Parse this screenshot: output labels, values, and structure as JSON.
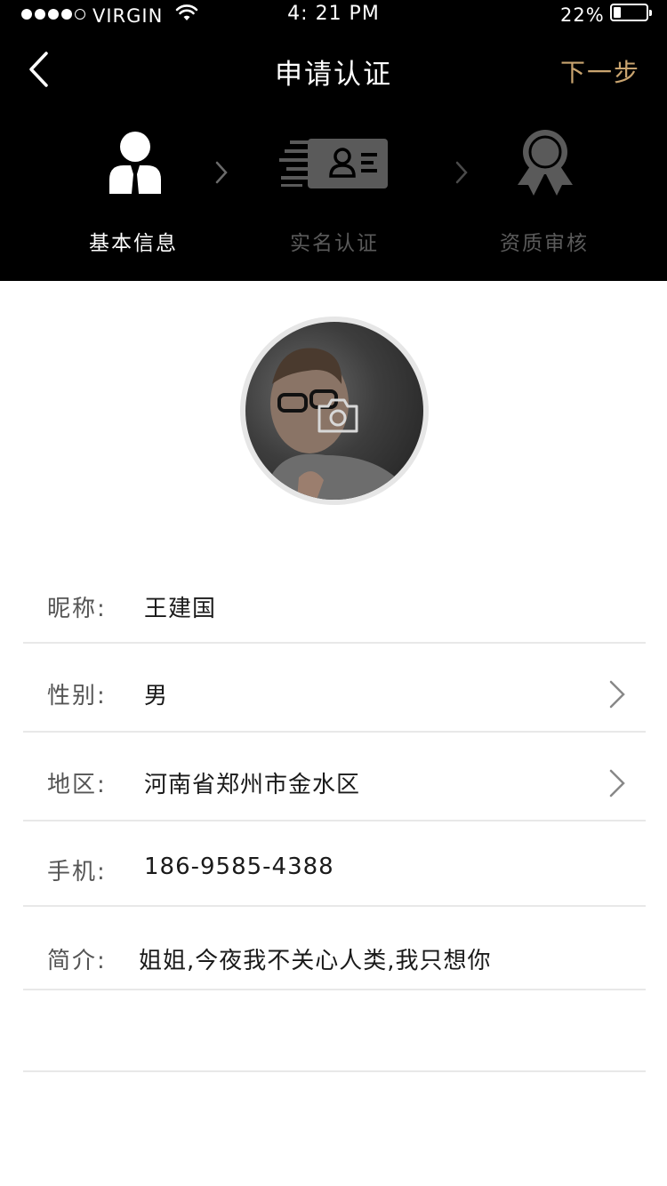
{
  "status_bar": {
    "carrier": "VIRGIN",
    "time": "4: 21 PM",
    "battery": "22%"
  },
  "nav": {
    "title": "申请认证",
    "next": "下一步"
  },
  "steps": [
    {
      "label": "基本信息",
      "icon": "person-icon",
      "state": "active"
    },
    {
      "label": "实名认证",
      "icon": "id-card-icon",
      "state": "inactive"
    },
    {
      "label": "资质审核",
      "icon": "award-ribbon-icon",
      "state": "inactive"
    }
  ],
  "avatar": {
    "icon": "camera-icon"
  },
  "form": {
    "nickname": {
      "label": "昵称:",
      "value": "王建国"
    },
    "gender": {
      "label": "性别:",
      "value": "男"
    },
    "region": {
      "label": "地区:",
      "value": "河南省郑州市金水区"
    },
    "phone": {
      "label": "手机:",
      "value": "186-9585-4388"
    },
    "bio": {
      "label": "简介:",
      "value": "姐姐,今夜我不关心人类,我只想你"
    }
  },
  "colors": {
    "header_bg": "#000000",
    "accent": "#c9a46f",
    "inactive": "#5a5a5a",
    "divider": "#e8e8e8"
  }
}
